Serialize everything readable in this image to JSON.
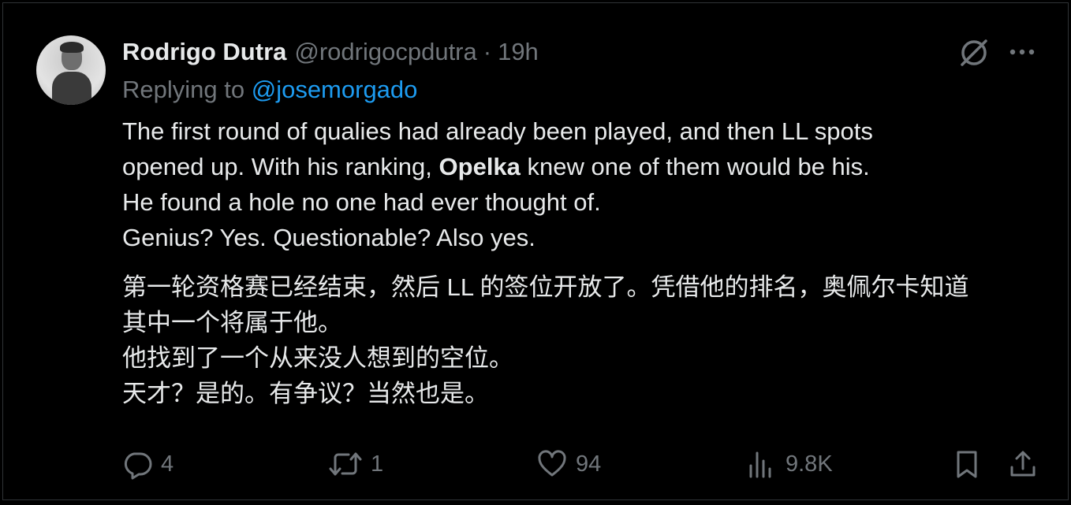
{
  "tweet": {
    "author": {
      "name": "Rodrigo Dutra",
      "handle": "@rodrigocpdutra",
      "separator": "·",
      "time": "19h"
    },
    "reply": {
      "prefix": "Replying to",
      "mention": "@josemorgado"
    },
    "text_en": {
      "line1": "The first round of qualies had already been played, and then LL spots",
      "line2_pre": "opened up. With his ranking, ",
      "line2_bold": "Opelka",
      "line2_post": " knew one of them would be his.",
      "line3": "He found a hole no one had ever thought of.",
      "line4": "Genius? Yes. Questionable? Also yes."
    },
    "text_zh": {
      "line1": "第一轮资格赛已经结束，然后 LL 的签位开放了。凭借他的排名，奥佩尔卡知道",
      "line2": "其中一个将属于他。",
      "line3": "他找到了一个从来没人想到的空位。",
      "line4": "天才？是的。有争议？当然也是。"
    }
  },
  "actions": {
    "replies": "4",
    "reposts": "1",
    "likes": "94",
    "views": "9.8K"
  },
  "icons": {
    "top_right": [
      "grok-icon",
      "more-icon"
    ],
    "action_bar": [
      "reply-icon",
      "repost-icon",
      "like-icon",
      "views-icon",
      "bookmark-icon",
      "share-icon"
    ]
  },
  "colors": {
    "background": "#000000",
    "text": "#e7e9ea",
    "muted": "#71767b",
    "link": "#1d9bf0"
  }
}
